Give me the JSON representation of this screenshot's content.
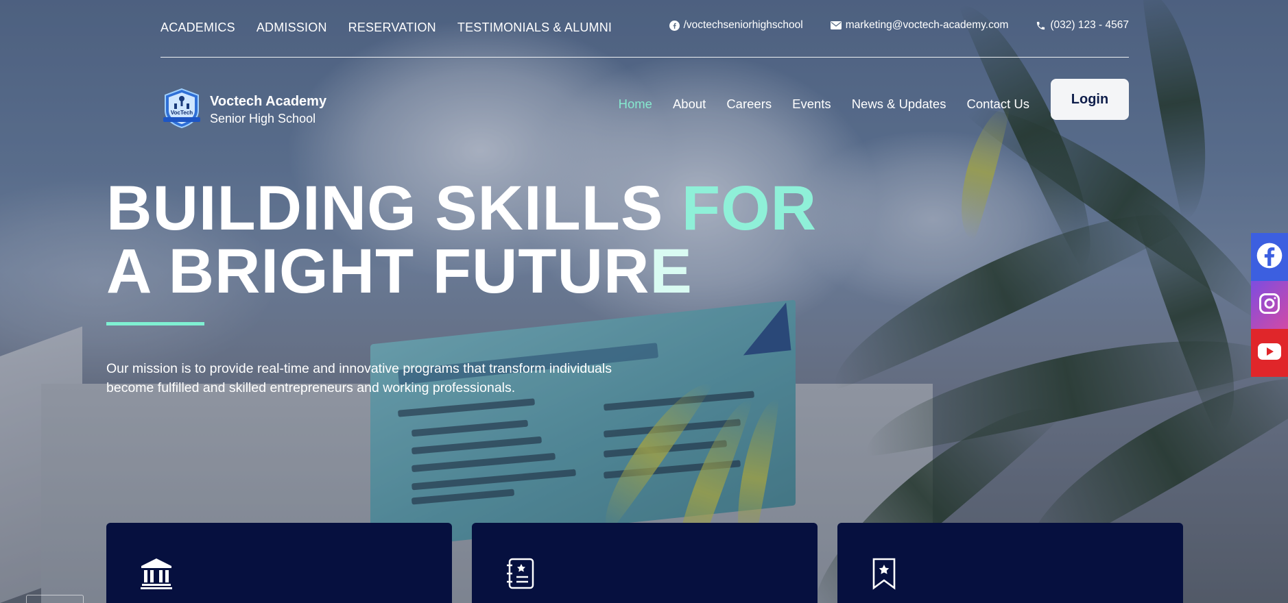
{
  "topbar": {
    "nav": [
      "ACADEMICS",
      "ADMISSION",
      "RESERVATION",
      "TESTIMONIALS & ALUMNI"
    ],
    "facebook": "/voctechseniorhighschool",
    "email": "marketing@voctech-academy.com",
    "phone": "(032) 123 - 4567"
  },
  "header": {
    "brand_name": "Voctech Academy",
    "brand_sub": "Senior High School",
    "logo_text": "VocTech",
    "nav": [
      "Home",
      "About",
      "Careers",
      "Events",
      "News & Updates",
      "Contact Us"
    ],
    "active_nav": "Home",
    "login_label": "Login"
  },
  "hero": {
    "line1_main": "BUILDING SKILLS ",
    "line1_accent": "FOR",
    "line2_main": "A BRIGHT FUTUR",
    "line2_fade": "E",
    "mission": "Our mission is to provide real-time and innovative programs that transform individuals become fulfilled and skilled entrepreneurs and working professionals."
  },
  "cards": [
    {
      "icon": "institution-icon"
    },
    {
      "icon": "notebook-icon"
    },
    {
      "icon": "bookmark-star-icon"
    }
  ],
  "social": [
    "facebook-icon",
    "instagram-icon",
    "youtube-icon"
  ],
  "colors": {
    "accent": "#86e9cf",
    "card_bg": "#06103f",
    "login_text": "#0e1d4a"
  }
}
